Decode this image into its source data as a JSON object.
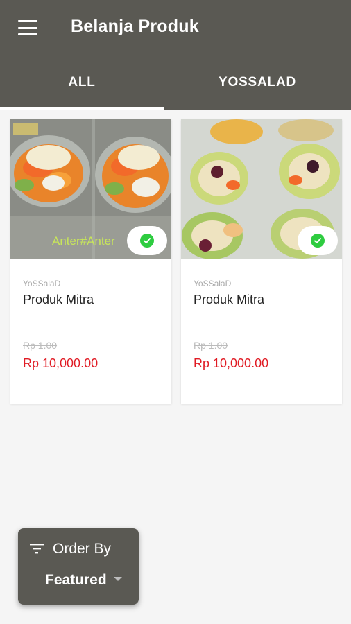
{
  "header": {
    "title": "Belanja Produk",
    "menu_icon": "hamburger-menu-icon"
  },
  "tabs": [
    {
      "label": "ALL",
      "active": true
    },
    {
      "label": "YOSSALAD",
      "active": false
    }
  ],
  "products": [
    {
      "seller": "YoSSalaD",
      "name": "Produk Mitra",
      "old_price": "Rp 1.00",
      "price": "Rp 10,000.00",
      "image_caption": "Anter#Anter",
      "badge_icon": "check-circle-icon"
    },
    {
      "seller": "YoSSalaD",
      "name": "Produk Mitra",
      "old_price": "Rp 1.00",
      "price": "Rp 10,000.00",
      "badge_icon": "check-circle-icon"
    }
  ],
  "order_by": {
    "label": "Order By",
    "value": "Featured",
    "icon": "filter-icon"
  },
  "colors": {
    "appbar": "#5a5953",
    "price": "#e01b24",
    "check": "#2ecc40"
  }
}
